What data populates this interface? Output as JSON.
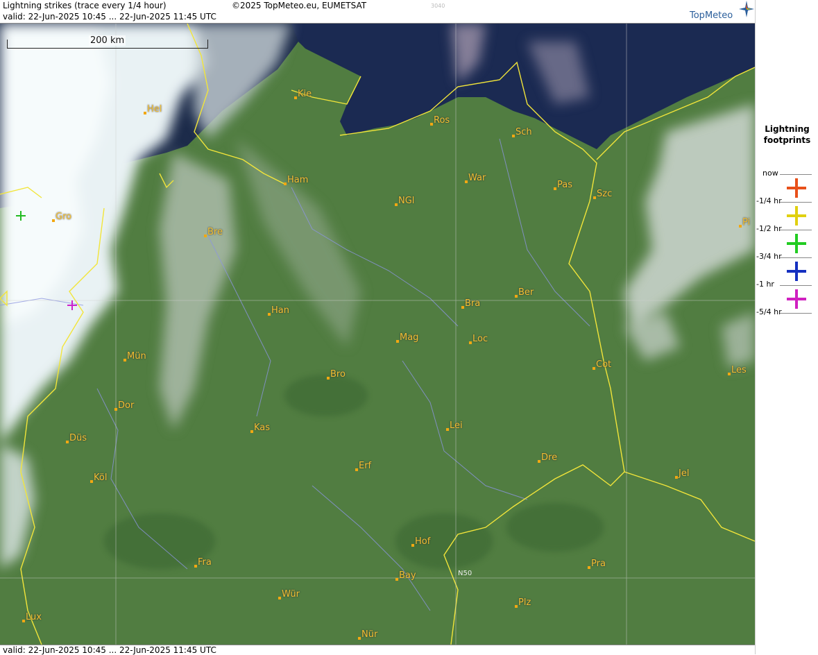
{
  "header": {
    "title": "Lightning strikes (trace every 1/4 hour)",
    "valid": "valid:  22-Jun-2025 10:45 ... 22-Jun-2025 11:45 UTC",
    "copyright": "©2025 TopMeteo.eu, EUMETSAT",
    "code": "3040",
    "brand": "TopMeteo"
  },
  "footer": {
    "valid": "valid:  22-Jun-2025 10:45 ... 22-Jun-2025 11:45 UTC"
  },
  "map": {
    "scale_label": "200 km",
    "grid_label": "N50",
    "cities": [
      "Kie",
      "Hel",
      "Ros",
      "Sch",
      "Ham",
      "War",
      "Pas",
      "Szc",
      "NGl",
      "Gro",
      "Bre",
      "Pi",
      "Han",
      "Bra",
      "Ber",
      "Mag",
      "Loc",
      "Mün",
      "Cot",
      "Bro",
      "Les",
      "Dor",
      "Kas",
      "Lei",
      "Düs",
      "Erf",
      "Dre",
      "Köl",
      "Jel",
      "Hof",
      "Fra",
      "Pra",
      "Bay",
      "Wür",
      "Plz",
      "Lux",
      "Nür"
    ],
    "strikes": [
      {
        "age": "-1/2 hr",
        "color": "#22bb22"
      },
      {
        "age": "-1 hr",
        "color": "#cc22cc"
      }
    ]
  },
  "legend": {
    "title_line1": "Lightning",
    "title_line2": "footprints",
    "ticks": [
      "now",
      "-1/4 hr",
      "-1/2 hr",
      "-3/4 hr",
      "-1 hr",
      "-5/4 hr"
    ],
    "colors": [
      "#e8501a",
      "#e0d010",
      "#22cc22",
      "#1530c0",
      "#d020c0"
    ]
  }
}
